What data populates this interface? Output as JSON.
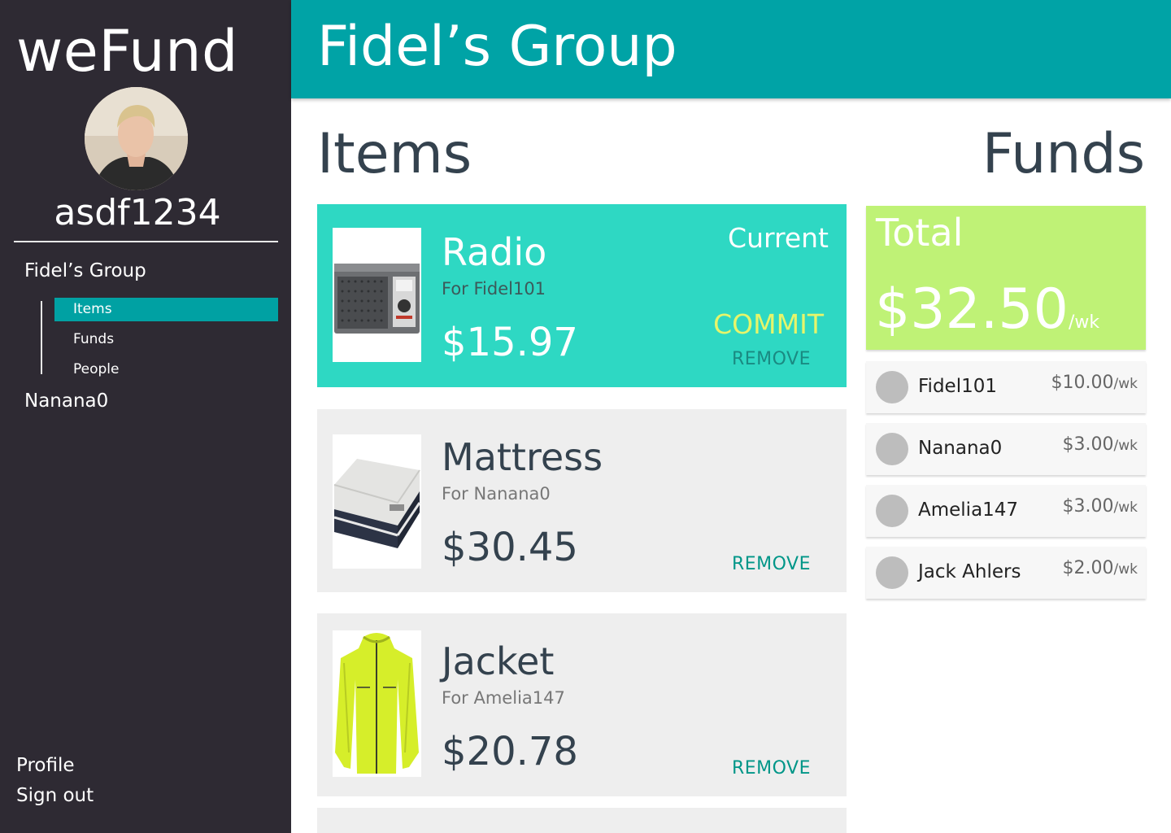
{
  "sidebar": {
    "brand": "weFund",
    "username": "asdf1234",
    "groups": [
      {
        "label": "Fidel’s Group",
        "subitems": [
          "Items",
          "Funds",
          "People"
        ],
        "active": "Items"
      },
      {
        "label": "Nanana0"
      }
    ],
    "profile_label": "Profile",
    "signout_label": "Sign out"
  },
  "header": {
    "title": "Fidel’s Group"
  },
  "items_section": {
    "title": "Items",
    "cards": [
      {
        "name": "Radio",
        "for": "For Fidel101",
        "price": "$15.97",
        "status": "Current",
        "commit_label": "COMMIT",
        "remove_label": "REMOVE"
      },
      {
        "name": "Mattress",
        "for": "For Nanana0",
        "price": "$30.45",
        "remove_label": "REMOVE"
      },
      {
        "name": "Jacket",
        "for": "For Amelia147",
        "price": "$20.78",
        "remove_label": "REMOVE"
      }
    ]
  },
  "funds_section": {
    "title": "Funds",
    "total_label": "Total",
    "total_amount": "$32.50",
    "total_unit": "/wk",
    "contributors": [
      {
        "name": "Fidel101",
        "amount": "$10.00",
        "unit": "/wk"
      },
      {
        "name": "Nanana0",
        "amount": "$3.00",
        "unit": "/wk"
      },
      {
        "name": "Amelia147",
        "amount": "$3.00",
        "unit": "/wk"
      },
      {
        "name": "Jack Ahlers",
        "amount": "$2.00",
        "unit": "/wk"
      }
    ]
  },
  "colors": {
    "sidebar": "#2e2a33",
    "accent": "#00a3a6",
    "current_card": "#2ed8c3",
    "total_card": "#bff276",
    "commit": "#e6f56a",
    "remove": "#009688"
  }
}
